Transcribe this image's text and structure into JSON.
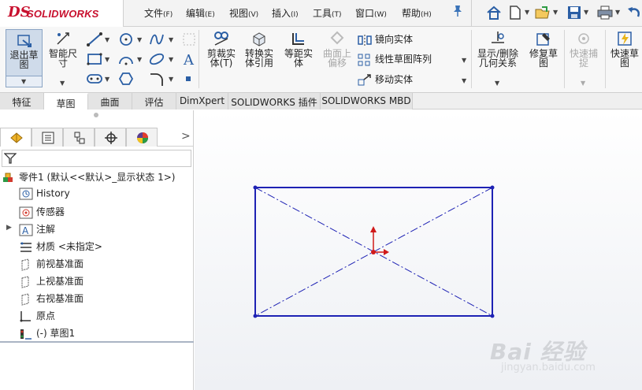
{
  "app": {
    "brand": "SOLIDWORKS",
    "brand_mark": "DS"
  },
  "menu": [
    {
      "label": "文件",
      "acc": "(F)"
    },
    {
      "label": "编辑",
      "acc": "(E)"
    },
    {
      "label": "视图",
      "acc": "(V)"
    },
    {
      "label": "插入",
      "acc": "(I)"
    },
    {
      "label": "工具",
      "acc": "(T)"
    },
    {
      "label": "窗口",
      "acc": "(W)"
    },
    {
      "label": "帮助",
      "acc": "(H)"
    }
  ],
  "ribbon": {
    "exit_sketch": "退出草\n图",
    "smart_dimension": "智能尺\n寸",
    "trim_entities": "剪裁实\n体(T)",
    "convert_entities": "转换实\n体引用",
    "offset_entities": "等距实\n体",
    "offset_on_surface": "曲面上\n偏移",
    "mirror_entities": "镜向实体",
    "linear_pattern": "线性草图阵列",
    "move_entities": "移动实体",
    "display_relations": "显示/删除\n几何关系",
    "repair_sketch": "修复草\n图",
    "quick_snaps": "快速捕\n捉",
    "rapid_sketch": "快速草\n图"
  },
  "tabs": [
    "特征",
    "草图",
    "曲面",
    "评估",
    "DimXpert",
    "SOLIDWORKS 插件",
    "SOLIDWORKS MBD"
  ],
  "active_tab": "草图",
  "tree": {
    "root": "零件1  (默认<<默认>_显示状态 1>)",
    "items": [
      {
        "label": "History",
        "icon": "history-icon"
      },
      {
        "label": "传感器",
        "icon": "sensor-icon"
      },
      {
        "label": "注解",
        "icon": "annotation-icon"
      },
      {
        "label": "材质 <未指定>",
        "icon": "material-icon"
      },
      {
        "label": "前视基准面",
        "icon": "plane-icon"
      },
      {
        "label": "上视基准面",
        "icon": "plane-icon"
      },
      {
        "label": "右视基准面",
        "icon": "plane-icon"
      },
      {
        "label": "原点",
        "icon": "origin-icon"
      },
      {
        "label": "(-) 草图1",
        "icon": "sketch-icon"
      }
    ]
  },
  "watermark": {
    "logo": "Bai 经验",
    "url": "jingyan.baidu.com"
  },
  "colors": {
    "sketch_blue": "#1e22b4",
    "origin_red": "#d01a1a",
    "brand_red": "#c8102e"
  }
}
